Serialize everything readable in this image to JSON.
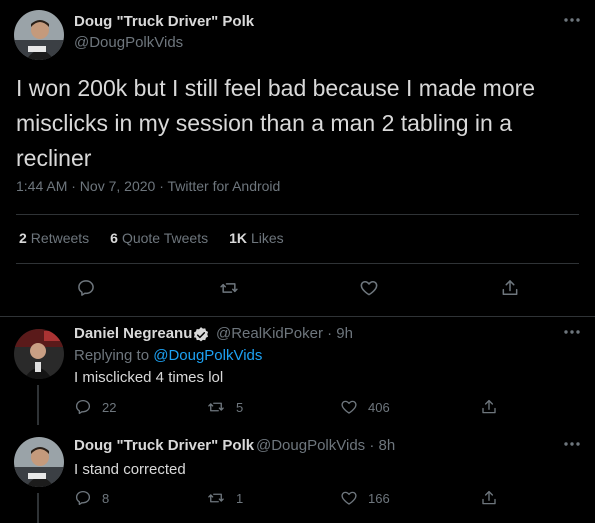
{
  "colors": {
    "background": "#000000",
    "text": "#d9d9d9",
    "secondary": "#6e767d",
    "link": "#1da1f2",
    "divider": "#2f3336"
  },
  "main_tweet": {
    "author_name": "Doug \"Truck Driver\" Polk",
    "author_handle": "@DougPolkVids",
    "text": "I won 200k but I still feel bad because I made more misclicks in my session than a man 2 tabling in a recliner",
    "timestamp": "1:44 AM · Nov 7, 2020 · Twitter for Android",
    "stats": {
      "retweets_count": "2",
      "retweets_label": "Retweets",
      "quotes_count": "6",
      "quotes_label": "Quote Tweets",
      "likes_count": "1K",
      "likes_label": "Likes"
    },
    "icons": [
      "more-icon",
      "reply-icon",
      "retweet-icon",
      "like-icon",
      "share-icon"
    ]
  },
  "replies": [
    {
      "author_name": "Daniel Negreanu",
      "verified": true,
      "author_handle": "@RealKidPoker · 9h",
      "replying_prefix": "Replying to",
      "replying_to": "@DougPolkVids",
      "text": "I misclicked 4 times lol",
      "reply_count": "22",
      "retweet_count": "5",
      "like_count": "406"
    },
    {
      "author_name": "Doug \"Truck Driver\" Polk",
      "verified": false,
      "author_handle": "@DougPolkVids · 8h",
      "text": "I stand corrected",
      "reply_count": "8",
      "retweet_count": "1",
      "like_count": "166"
    }
  ]
}
